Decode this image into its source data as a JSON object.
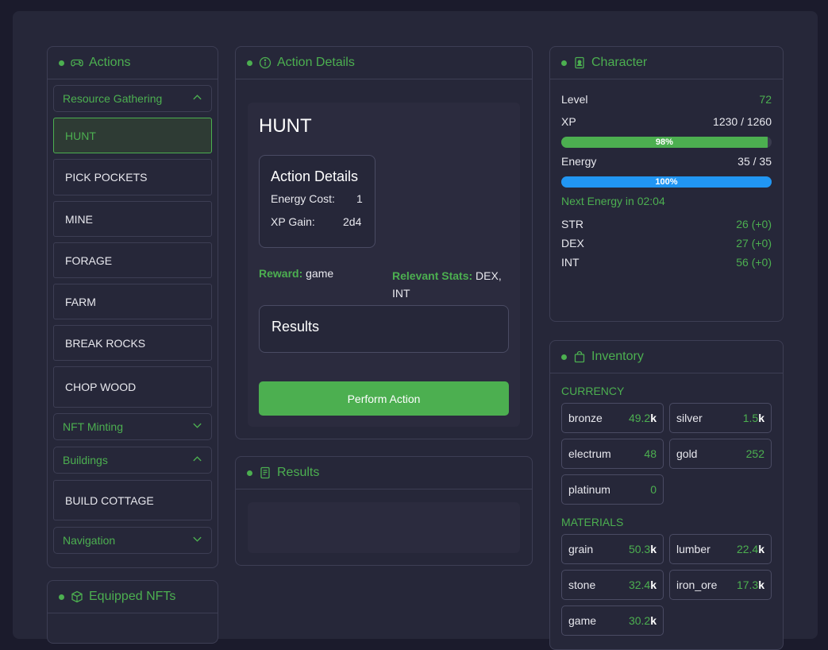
{
  "actions": {
    "title": "Actions",
    "groups": {
      "resource": {
        "label": "Resource Gathering",
        "items": [
          "HUNT",
          "PICK POCKETS",
          "MINE",
          "FORAGE",
          "FARM",
          "BREAK ROCKS",
          "CHOP WOOD"
        ],
        "selected": "HUNT"
      },
      "nft": {
        "label": "NFT Minting"
      },
      "buildings": {
        "label": "Buildings",
        "items": [
          "BUILD COTTAGE"
        ]
      },
      "navigation": {
        "label": "Navigation"
      }
    }
  },
  "equipped": {
    "title": "Equipped NFTs"
  },
  "details": {
    "title": "Action Details",
    "action_name": "HUNT",
    "box_title": "Action Details",
    "energy_cost_label": "Energy Cost:",
    "energy_cost": "1",
    "xp_gain_label": "XP Gain:",
    "xp_gain": "2d4",
    "reward_label": "Reward:",
    "reward": "game",
    "stats_label": "Relevant Stats:",
    "stats": "DEX, INT",
    "results_title": "Results",
    "perform_label": "Perform Action"
  },
  "results": {
    "title": "Results"
  },
  "character": {
    "title": "Character",
    "level_label": "Level",
    "level": "72",
    "xp_label": "XP",
    "xp": "1230 / 1260",
    "xp_pct": 98,
    "xp_pct_label": "98%",
    "energy_label": "Energy",
    "energy": "35 / 35",
    "energy_pct": 100,
    "energy_pct_label": "100%",
    "next_energy": "Next Energy in 02:04",
    "stats": [
      {
        "name": "STR",
        "value": "26 (+0)"
      },
      {
        "name": "DEX",
        "value": "27 (+0)"
      },
      {
        "name": "INT",
        "value": "56 (+0)"
      }
    ]
  },
  "inventory": {
    "title": "Inventory",
    "currency_label": "CURRENCY",
    "currency": [
      {
        "name": "bronze",
        "value": "49.2",
        "unit": "k"
      },
      {
        "name": "silver",
        "value": "1.5",
        "unit": "k"
      },
      {
        "name": "electrum",
        "value": "48",
        "unit": ""
      },
      {
        "name": "gold",
        "value": "252",
        "unit": ""
      },
      {
        "name": "platinum",
        "value": "0",
        "unit": ""
      }
    ],
    "materials_label": "MATERIALS",
    "materials": [
      {
        "name": "grain",
        "value": "50.3",
        "unit": "k"
      },
      {
        "name": "lumber",
        "value": "22.4",
        "unit": "k"
      },
      {
        "name": "stone",
        "value": "32.4",
        "unit": "k"
      },
      {
        "name": "iron_ore",
        "value": "17.3",
        "unit": "k"
      },
      {
        "name": "game",
        "value": "30.2",
        "unit": "k"
      }
    ]
  },
  "colors": {
    "accent": "#4caf50",
    "energy": "#2196f3",
    "background": "#262739"
  }
}
